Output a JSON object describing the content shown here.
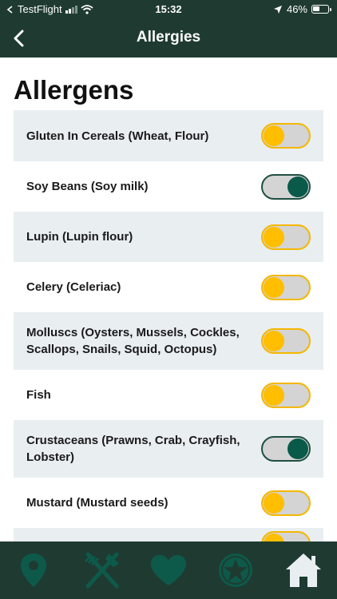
{
  "status_bar": {
    "carrier": "TestFlight",
    "time": "15:32",
    "battery": "46%",
    "battery_level": 0.46
  },
  "nav": {
    "title": "Allergies"
  },
  "section": {
    "title": "Allergens"
  },
  "allergens": [
    {
      "label": "Gluten In Cereals (Wheat, Flour)",
      "enabled": false
    },
    {
      "label": "Soy Beans (Soy milk)",
      "enabled": true
    },
    {
      "label": "Lupin (Lupin flour)",
      "enabled": false
    },
    {
      "label": "Celery (Celeriac)",
      "enabled": false
    },
    {
      "label": "Molluscs (Oysters, Mussels, Cockles, Scallops, Snails, Squid, Octopus)",
      "enabled": false
    },
    {
      "label": "Fish",
      "enabled": false
    },
    {
      "label": "Crustaceans (Prawns, Crab, Crayfish, Lobster)",
      "enabled": true
    },
    {
      "label": "Mustard (Mustard seeds)",
      "enabled": false
    },
    {
      "label": "",
      "enabled": false
    }
  ],
  "tabs": [
    {
      "icon": "map-pin-icon"
    },
    {
      "icon": "fork-knife-icon"
    },
    {
      "icon": "heart-icon"
    },
    {
      "icon": "star-badge-icon"
    },
    {
      "icon": "home-icon"
    }
  ],
  "colors": {
    "header_bg": "#1f3b31",
    "toggle_off_knob": "#ffbe00",
    "toggle_on_knob": "#0a5a49",
    "row_shaded": "#e9eef1",
    "tab_icon": "#0d5a4b"
  }
}
